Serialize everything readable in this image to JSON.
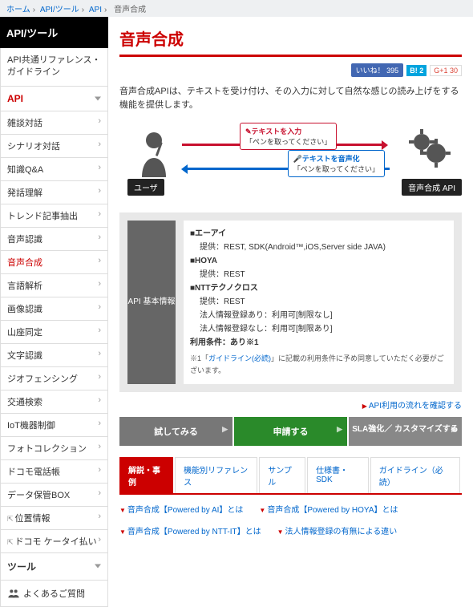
{
  "crumb": {
    "home": "ホーム",
    "tools": "API/ツール",
    "api": "API",
    "cur": "音声合成"
  },
  "side": {
    "hd": "API/ツール",
    "sub": "API共通リファレンス・ガイドライン",
    "api": "API",
    "items": [
      "雑談対話",
      "シナリオ対話",
      "知識Q&A",
      "発話理解",
      "トレンド記事抽出",
      "音声認識",
      "音声合成",
      "言語解析",
      "画像認識",
      "山座同定",
      "文字認識",
      "ジオフェンシング",
      "交通検索",
      "IoT機器制御",
      "フォトコレクション",
      "ドコモ電話帳",
      "データ保管BOX",
      "位置情報",
      "ドコモ ケータイ払い"
    ],
    "activeIdx": 6,
    "ext": [
      17,
      18
    ],
    "tool": "ツール",
    "faq": "よくあるご質問"
  },
  "page": {
    "title": "音声合成",
    "like": "いいね！ 395",
    "bnum": "B! 2",
    "gnum": "G+1  30",
    "desc": "音声合成APIは、テキストを受け付け、その入力に対して自然な感じの読み上げをする機能を提供します。",
    "dia": {
      "user": "ユーザ",
      "api": "音声合成 API",
      "in_t": "✎テキストを入力",
      "in_s": "「ペンを取ってください」",
      "out_t": "🎤テキストを音声化",
      "out_s": "「ペンを取ってください」"
    },
    "info": {
      "label": "API\n基本情報",
      "rows": [
        {
          "h": "■エーアイ",
          "b": "提供：REST, SDK(Android™,iOS,Server side JAVA)"
        },
        {
          "h": "■HOYA",
          "b": "提供：REST"
        },
        {
          "h": "■NTTテクノクロス",
          "b": "提供：REST\n法人情報登録あり：利用可[制限なし]\n法人情報登録なし：利用可[制限あり]"
        }
      ],
      "cond": "利用条件：あり※1",
      "note": "※1「ガイドライン(必読)」に記載の利用条件に予め同意していただく必要がございます。"
    },
    "flowlink": "API利用の流れを確認する",
    "cta": [
      "試してみる",
      "申請する",
      "SLA強化／\nカスタマイズする"
    ],
    "tabs": [
      "解説・事例",
      "機能別リファレンス",
      "サンプル",
      "仕様書・SDK",
      "ガイドライン（必読）"
    ],
    "anchors": [
      "音声合成【Powered by AI】とは",
      "音声合成【Powered by HOYA】とは",
      "音声合成【Powered by NTT-IT】とは",
      "法人情報登録の有無による違い"
    ]
  }
}
